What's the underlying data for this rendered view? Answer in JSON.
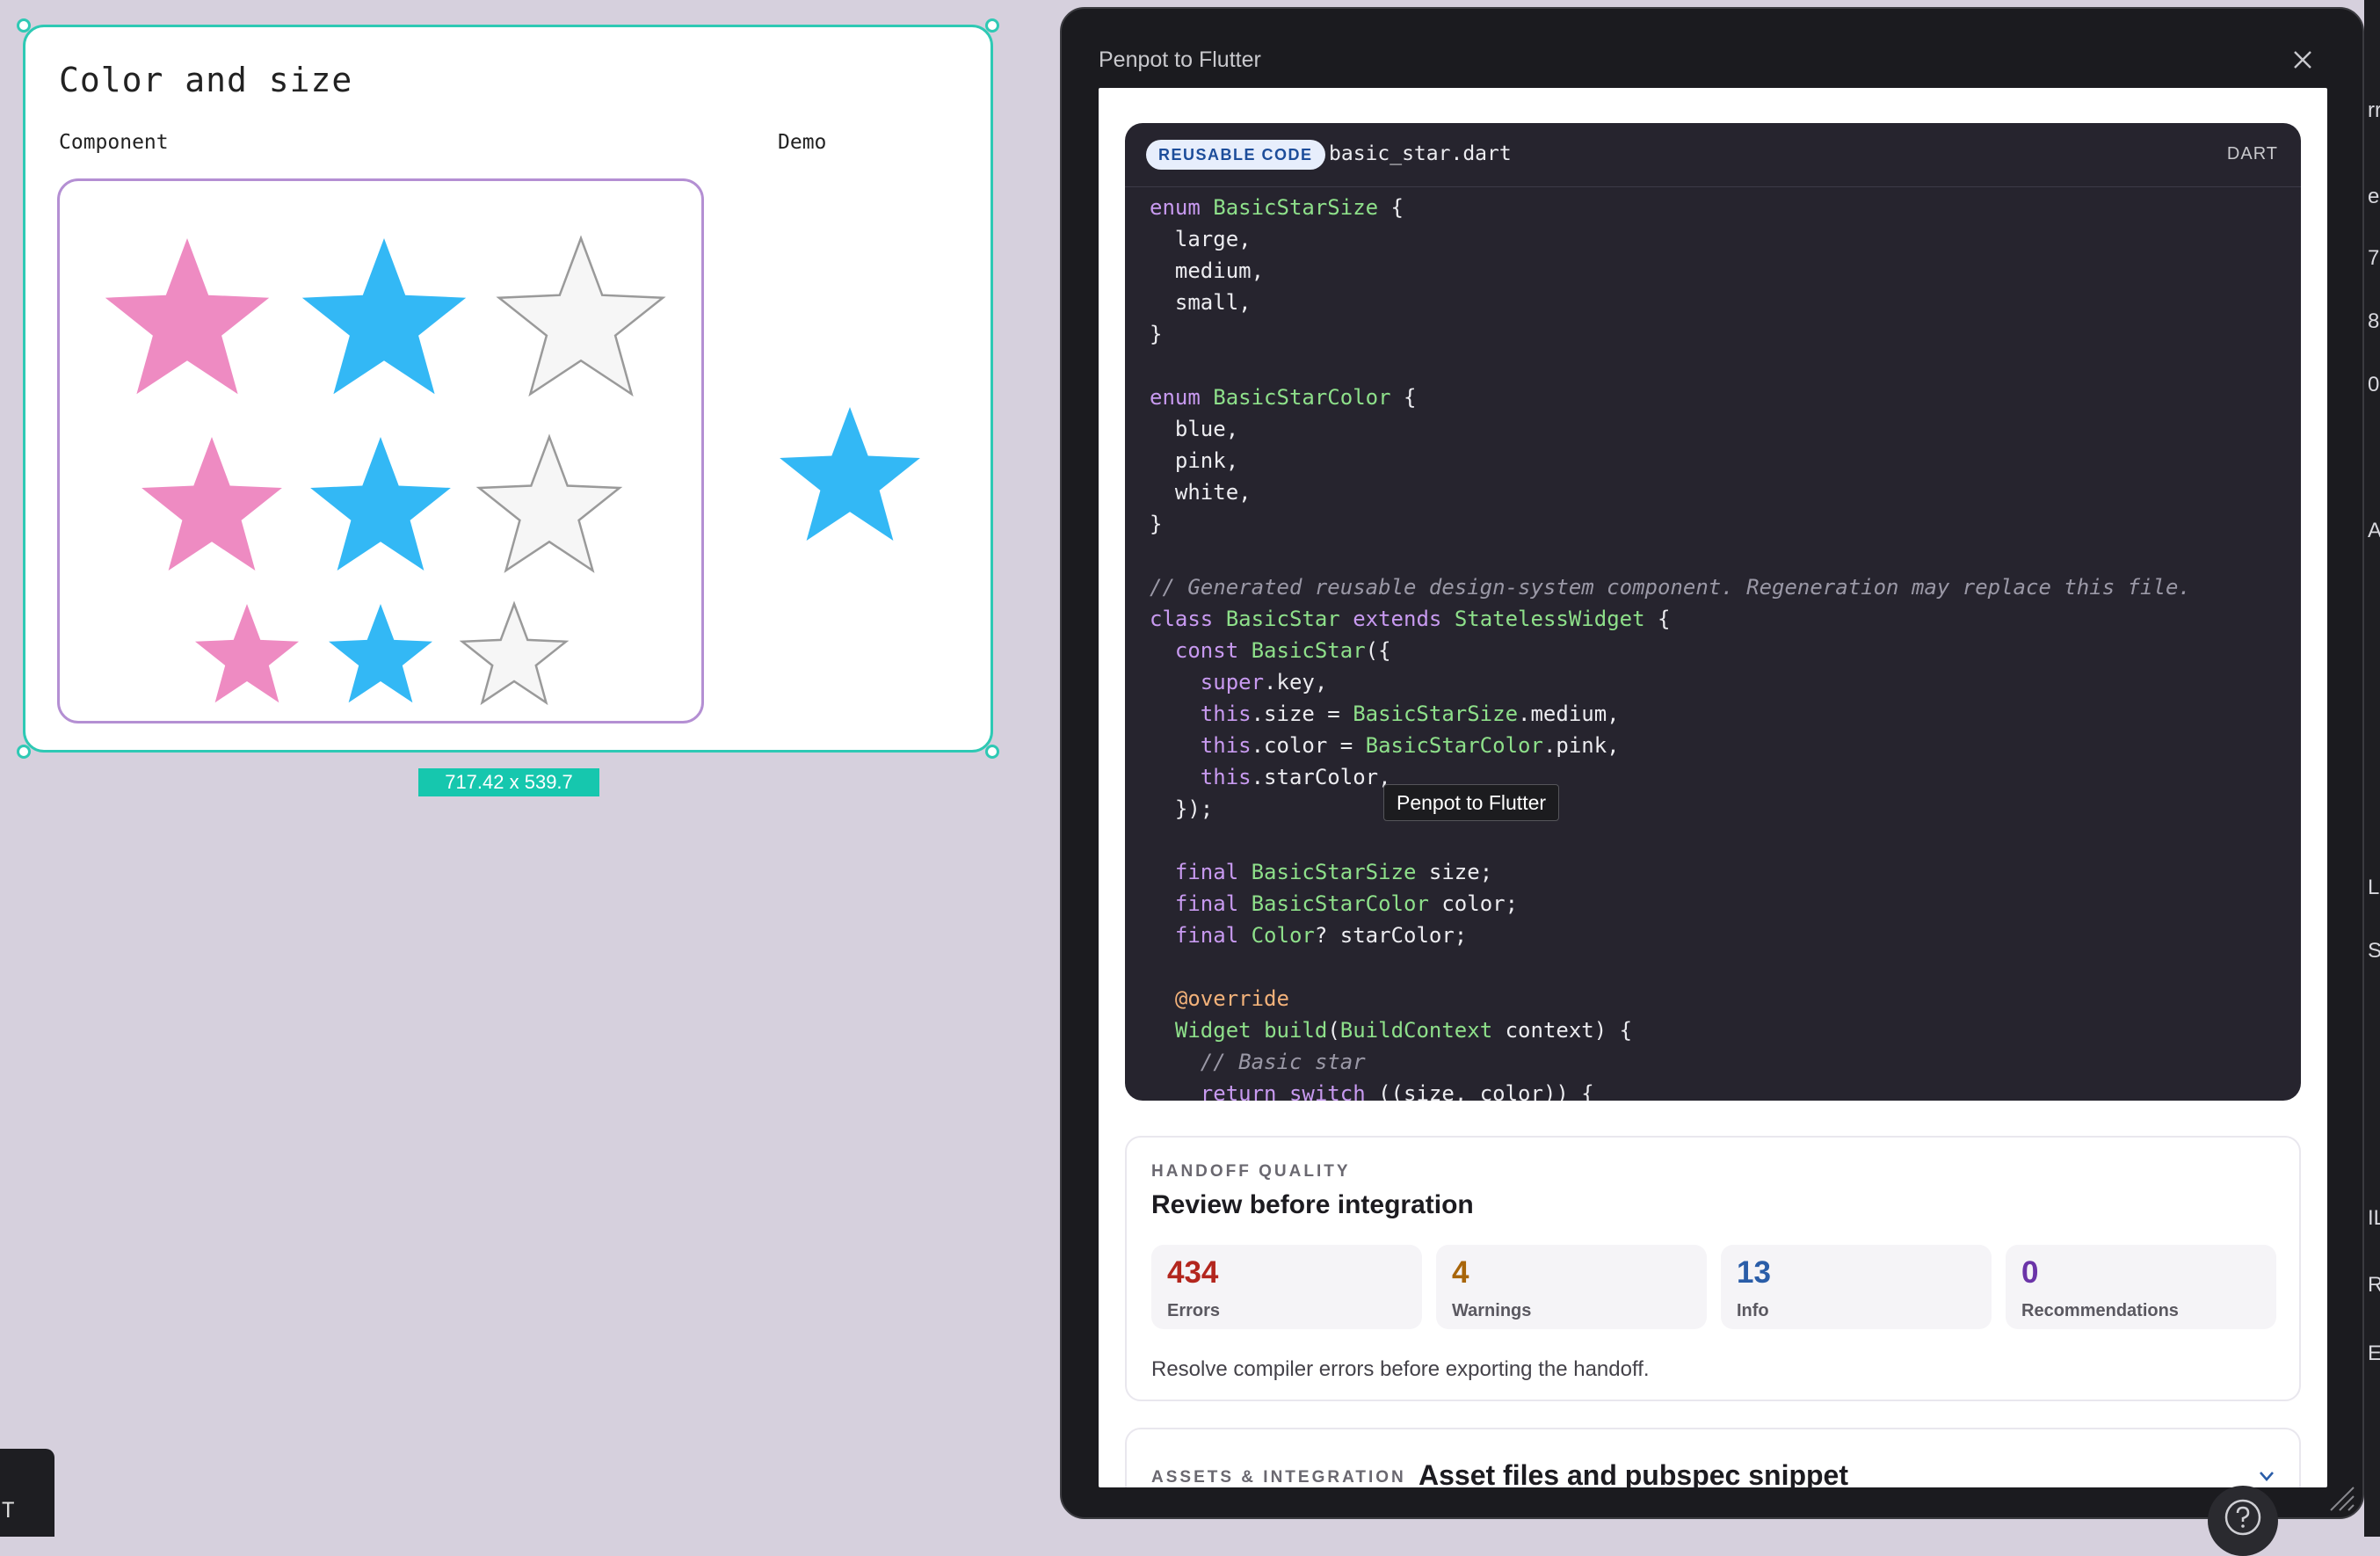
{
  "board": {
    "title": "Color and size",
    "component_label": "Component",
    "demo_label": "Demo",
    "size_badge": "717.42 x 539.7",
    "selection_color": "#2ec9b4",
    "stars": {
      "colors": {
        "pink": "#ee8bc2",
        "blue": "#33b8f5",
        "white": "#f6f6f6"
      },
      "rows": [
        {
          "size": "large",
          "colors": [
            "pink",
            "blue",
            "white"
          ]
        },
        {
          "size": "medium",
          "colors": [
            "pink",
            "blue",
            "white"
          ]
        },
        {
          "size": "small",
          "colors": [
            "pink",
            "blue",
            "white"
          ]
        }
      ],
      "demo": {
        "size": "medium",
        "color": "blue"
      }
    }
  },
  "panel": {
    "title": "Penpot to Flutter",
    "close_icon": "close-icon",
    "code": {
      "badge": "REUSABLE CODE",
      "file_name": "basic_star.dart",
      "language": "DART",
      "lines": [
        "enum BasicStarSize {",
        "  large,",
        "  medium,",
        "  small,",
        "}",
        "",
        "enum BasicStarColor {",
        "  blue,",
        "  pink,",
        "  white,",
        "}",
        "",
        "// Generated reusable design-system component. Regeneration may replace this file.",
        "class BasicStar extends StatelessWidget {",
        "  const BasicStar({",
        "    super.key,",
        "    this.size = BasicStarSize.medium,",
        "    this.color = BasicStarColor.pink,",
        "    this.starColor,",
        "  });",
        "",
        "  final BasicStarSize size;",
        "  final BasicStarColor color;",
        "  final Color? starColor;",
        "",
        "  @override",
        "  Widget build(BuildContext context) {",
        "    // Basic star",
        "    return switch ((size, color)) {"
      ]
    },
    "tooltip": "Penpot to Flutter",
    "quality": {
      "eyebrow": "HANDOFF QUALITY",
      "title": "Review before integration",
      "stats": [
        {
          "value": "434",
          "label": "Errors",
          "color": "#b3261e"
        },
        {
          "value": "4",
          "label": "Warnings",
          "color": "#a8650a"
        },
        {
          "value": "13",
          "label": "Info",
          "color": "#2a5da8"
        },
        {
          "value": "0",
          "label": "Recommendations",
          "color": "#6b34a8"
        }
      ],
      "note": "Resolve compiler errors before exporting the handoff."
    },
    "assets": {
      "eyebrow": "ASSETS & INTEGRATION",
      "title": "Asset files and pubspec snippet"
    }
  },
  "edge": {
    "corner_char": "T",
    "strip_chars": [
      "rr",
      "e",
      "7",
      "8",
      "0",
      "AY",
      "LL",
      "STA",
      "IL",
      "R",
      "E"
    ]
  }
}
